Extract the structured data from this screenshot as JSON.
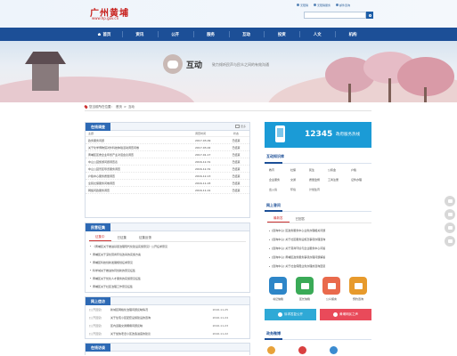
{
  "header": {
    "logo_title": "广州黄埔",
    "logo_url": "www.hp.gov.cn",
    "top_links": [
      {
        "label": "无障碍",
        "icon": "accessibility-icon"
      },
      {
        "label": "无障碍服务",
        "icon": "wheelchair-icon"
      },
      {
        "label": "邮件咨询",
        "icon": "mail-icon"
      }
    ],
    "search": {
      "placeholder": "",
      "icon": "search-icon"
    }
  },
  "nav": {
    "items": [
      {
        "label": "首页",
        "icon": "home-icon"
      },
      {
        "label": "资讯"
      },
      {
        "label": "公开"
      },
      {
        "label": "服务"
      },
      {
        "label": "互动"
      },
      {
        "label": "投资"
      },
      {
        "label": "人文"
      },
      {
        "label": "机构"
      }
    ]
  },
  "banner": {
    "title": "互动",
    "subtitle": "致力倾听民声与民众之间的有效沟通",
    "icon": "chat-bubble-icon"
  },
  "breadcrumb": {
    "prefix": "您当前所在位置：",
    "home": "首页",
    "separator": ">",
    "current": "互动"
  },
  "survey": {
    "tab": "在线调查",
    "more": "更多",
    "columns": [
      "主题",
      "调查时间",
      "状态"
    ],
    "rows": [
      {
        "topic": "政务服务问题",
        "date": "2017-03-09",
        "status": "已结束"
      },
      {
        "topic": "关于化学博物馆对外科技体验活动调查问卷",
        "date": "2017-03-02",
        "status": "已结束"
      },
      {
        "topic": "黄埔区区委企业年终产业对话会议调查",
        "date": "2017-01-17",
        "status": "已结束"
      },
      {
        "topic": "中山公园旅游问题调查表",
        "date": "2016-12-31",
        "status": "已结束"
      },
      {
        "topic": "中山公园景区导览服务调查",
        "date": "2016-12-31",
        "status": "已结束"
      },
      {
        "topic": "户籍中心服务质量调查",
        "date": "2016-12-13",
        "status": "已结束"
      },
      {
        "topic": "全民社保服务问卷调查",
        "date": "2016-11-03",
        "status": "已结束"
      },
      {
        "topic": "网络问政服务调查",
        "date": "2016-11-01",
        "status": "已结束"
      }
    ]
  },
  "opinion": {
    "tab": "民意征集",
    "subtabs": [
      "征集中",
      "已征集",
      "征集反馈"
    ],
    "items": [
      "《黄埔区关于推进基层治理现代化建设实施意见》公开征求意见",
      "黄埔区关于深化营商环境改革的实施方案",
      "黄埔区科技创新发展规划征求意见",
      "科学城关于推进协同创新的意见征集",
      "黄埔区关于优化人才服务的实施意见征集",
      "黄埔区关于社区治理工作意见征集",
      "黄埔区城市更新规划（草案）征求意见"
    ]
  },
  "interaction": {
    "tab": "网上信访",
    "rows": [
      {
        "cat": "[公开回复]",
        "title": "新城区网格化治理问题反映情况",
        "date": "2016-11-25"
      },
      {
        "cat": "[公开回复]",
        "title": "关于住宅小区配套设施建设的咨询",
        "date": "2016-11-24"
      },
      {
        "cat": "[公开回复]",
        "title": "区内道路交通拥堵问题反映",
        "date": "2016-11-23"
      },
      {
        "cat": "[公开回复]",
        "title": "关于加快老旧小区改造进度的建议",
        "date": "2016-11-22"
      },
      {
        "cat": "[公开回复]",
        "title": "学区划分相关问题的咨询",
        "date": "2016-11-21"
      },
      {
        "cat": "[公开回复]",
        "title": "关于公共服务设施建设的意见反馈",
        "date": "2015-04-22"
      }
    ]
  },
  "online_interview": {
    "tab": "在线访谈"
  },
  "hotline": {
    "number": "12345",
    "label": "政府服务热线",
    "icon": "phone-icon"
  },
  "knowledge": {
    "title": "互动知识库",
    "items": [
      "教育",
      "社保",
      "民生",
      "公积金",
      "户籍",
      "企业服务",
      "交通",
      "质量监督",
      "工商注册",
      "证件办理",
      "出入境",
      "环境",
      "计划生育",
      "城市管理",
      "劳务",
      "其他"
    ]
  },
  "netq": {
    "title": "网上答问",
    "subtabs": [
      "最新答",
      "已回答"
    ],
    "items": [
      "[咨询中心] 区政务服务中心业务办理相关问题",
      "[咨询中心] 关于社区服务设施及事项办理咨询",
      "[咨询中心] 关于营商环境与企业服务中心问答",
      "[咨询中心] 黄埔区政务服务事项办理问题解答",
      "[咨询中心] 关于社会保障业务办理的咨询回复",
      "[咨询中心] 关于住房公积金业务办理咨询"
    ]
  },
  "services": {
    "tiles": [
      {
        "label": "书记信箱",
        "icon": "mail-icon",
        "color": "#2e86c8"
      },
      {
        "label": "区长信箱",
        "icon": "envelope-icon",
        "color": "#3aaa57"
      },
      {
        "label": "公众留言",
        "icon": "chat-icon",
        "color": "#e96a4c"
      },
      {
        "label": "预约咨询",
        "icon": "calendar-icon",
        "color": "#e79a2c"
      }
    ],
    "buttons": [
      {
        "label": "诉求答复公开",
        "icon": "reply-icon",
        "color": "#2fa9d6"
      },
      {
        "label": "黄埔网民之声",
        "icon": "voice-icon",
        "color": "#e94a5a"
      }
    ]
  },
  "weibo": {
    "title": "政务微博"
  },
  "floats": [
    "wechat-icon",
    "weibo-icon",
    "mobile-icon",
    "top-icon"
  ]
}
